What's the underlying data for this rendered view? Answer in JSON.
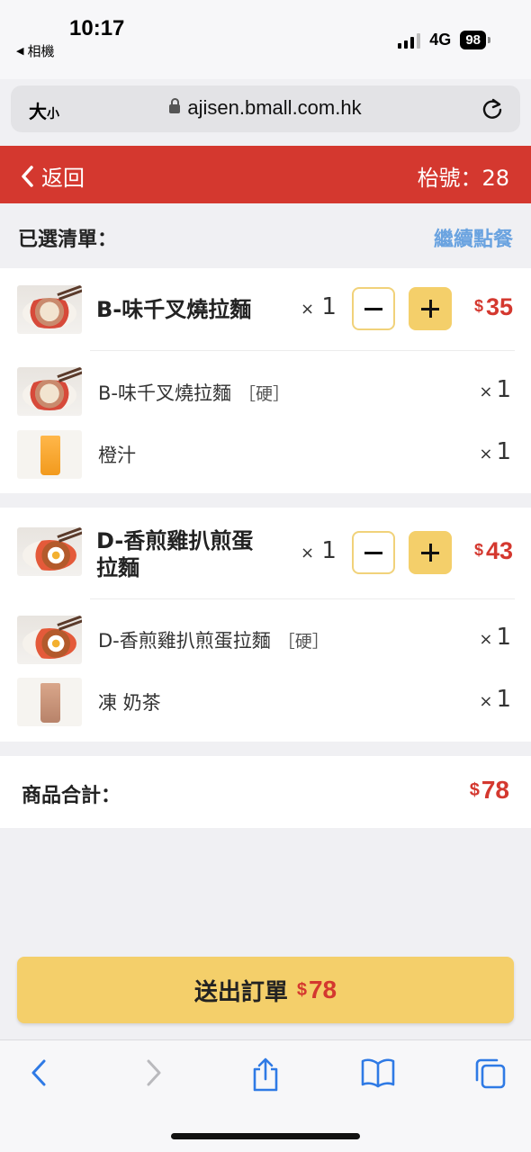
{
  "status_bar": {
    "time": "10:17",
    "back_app": "相機",
    "network": "4G",
    "battery": "98"
  },
  "browser": {
    "text_size": "大",
    "text_size_small": "小",
    "url": "ajisen.bmall.com.hk"
  },
  "header": {
    "back_label": "返回",
    "table_label": "枱號：28",
    "color": "#d4382f"
  },
  "order": {
    "title": "已選清單：",
    "continue_label": "繼續點餐",
    "items": [
      {
        "name": "B-味千叉燒拉麵",
        "qty_x": "×",
        "qty": "1",
        "currency": "$",
        "price": "35",
        "subs": [
          {
            "name": "B-味千叉燒拉麵",
            "option": "［硬］",
            "qty_x": "×",
            "qty": "1"
          },
          {
            "name": "橙汁",
            "option": "",
            "qty_x": "×",
            "qty": "1"
          }
        ]
      },
      {
        "name_line1": "D-香煎雞扒煎蛋",
        "name_line2": "拉麵",
        "qty_x": "×",
        "qty": "1",
        "currency": "$",
        "price": "43",
        "subs": [
          {
            "name": "D-香煎雞扒煎蛋拉麵",
            "option": "［硬］",
            "qty_x": "×",
            "qty": "1"
          },
          {
            "name": "凍 奶茶",
            "option": "",
            "qty_x": "×",
            "qty": "1"
          }
        ]
      }
    ]
  },
  "total": {
    "label": "商品合計：",
    "currency": "$",
    "amount": "78"
  },
  "submit": {
    "label": "送出訂單",
    "currency": "$",
    "amount": "78",
    "color": "#f4cf6a"
  },
  "toolbar": {
    "icons": [
      "back-icon",
      "forward-icon",
      "share-icon",
      "bookmarks-icon",
      "tabs-icon"
    ]
  }
}
